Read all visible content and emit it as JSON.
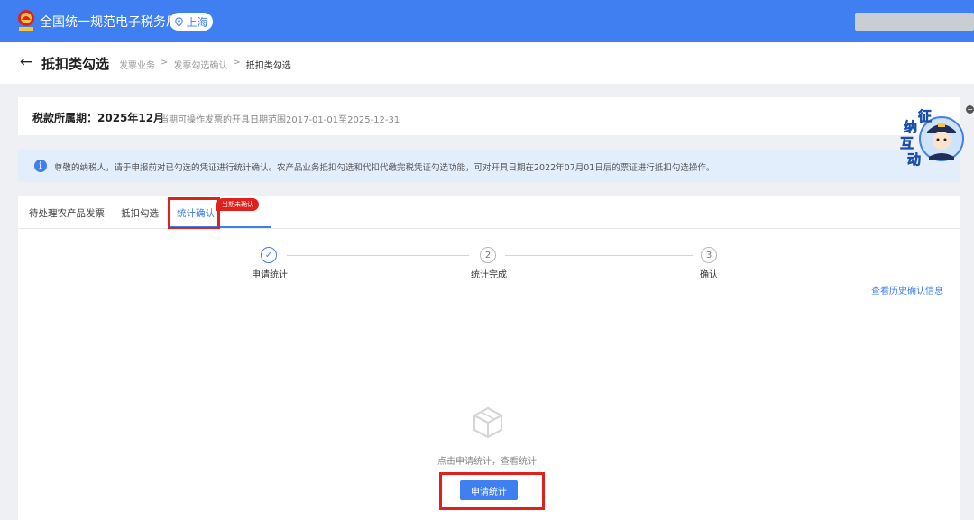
{
  "app": {
    "title": "全国统一规范电子税务局",
    "location": "上海"
  },
  "header": {
    "back_icon": "arrow-left-icon",
    "page_title": "抵扣类勾选",
    "breadcrumb": [
      "发票业务",
      "发票勾选确认",
      "抵扣类勾选"
    ],
    "breadcrumb_sep": ">"
  },
  "period": {
    "label": "税款所属期：2025年12月",
    "range_text": "当期可操作发票的开具日期范围2017-01-01至2025-12-31"
  },
  "notice": {
    "icon": "info-icon",
    "text": "尊敬的纳税人，请于申报前对已勾选的凭证进行统计确认。农产品业务抵扣勾选和代扣代缴完税凭证勾选功能，可对开具日期在2022年07月01日后的票证进行抵扣勾选操作。"
  },
  "tabs": [
    {
      "label": "待处理农产品发票"
    },
    {
      "label": "抵扣勾选"
    },
    {
      "label": "统计确认",
      "active": true,
      "badge": "当期未确认"
    }
  ],
  "steps": [
    {
      "num": "✓",
      "label": "申请统计",
      "done": true
    },
    {
      "num": "2",
      "label": "统计完成",
      "done": false
    },
    {
      "num": "3",
      "label": "确认",
      "done": false
    }
  ],
  "history_link": "查看历史确认信息",
  "empty": {
    "icon": "empty-box-icon",
    "text": "点击申请统计，查看统计"
  },
  "apply_button": "申请统计",
  "mascot": {
    "chars": [
      "征",
      "纳",
      "互",
      "动"
    ],
    "close": "−"
  },
  "colors": {
    "primary": "#3f7ff2",
    "highlight": "#e0201b",
    "notice_bg": "#e3eefc"
  }
}
